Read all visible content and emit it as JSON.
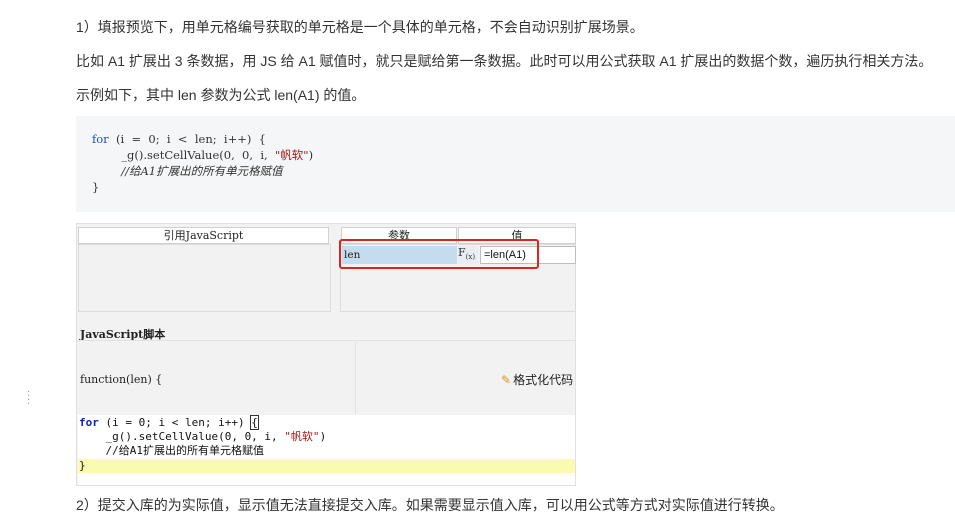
{
  "paragraphs": {
    "p1": "1）填报预览下，用单元格编号获取的单元格是一个具体的单元格，不会自动识别扩展场景。",
    "p2": "比如 A1 扩展出 3 条数据，用 JS 给 A1 赋值时，就只是赋给第一条数据。此时可以用公式获取 A1 扩展出的数据个数，遍历执行相关方法。",
    "p3": "示例如下，其中 len 参数为公式 len(A1) 的值。",
    "p4": "2）提交入库的为实际值，显示值无法直接提交入库。如果需要显示值入库，可以用公式等方式对实际值进行转换。"
  },
  "code_block": {
    "l1_kw": "for",
    "l1_rest": "  (i  =  0;  i  <  len;  i++)  {",
    "l2_a": "        _g().setCellValue(0,  0,  i,  ",
    "l2_str": "\"帆软\"",
    "l2_end": ")",
    "l3": "        //给A1扩展出的所有单元格赋值",
    "l4": "}"
  },
  "designer": {
    "header_ref_js": "引用JavaScript",
    "header_param": "参数",
    "header_value": "值",
    "param_name": "len",
    "fx_label": "F",
    "fx_sub": "(x)",
    "param_value": "=len(A1)",
    "js_script_label": "JavaScript脚本",
    "function_signature": "function(len) {",
    "format_code_button": "格式化代码",
    "editor": {
      "l1_kw": "for",
      "l1_rest": " (i = 0; i < len; i++) ",
      "l1_brace": "{",
      "l2_a": "    _g().setCellValue(0, 0, i, ",
      "l2_str": "\"帆软\"",
      "l2_end": ")",
      "l3": "    //给A1扩展出的所有单元格赋值",
      "l4": "}"
    }
  },
  "colors": {
    "highlight_box": "#e0241b",
    "param_cell_bg": "#c5dcee",
    "keyword": "#1f4fb3"
  }
}
